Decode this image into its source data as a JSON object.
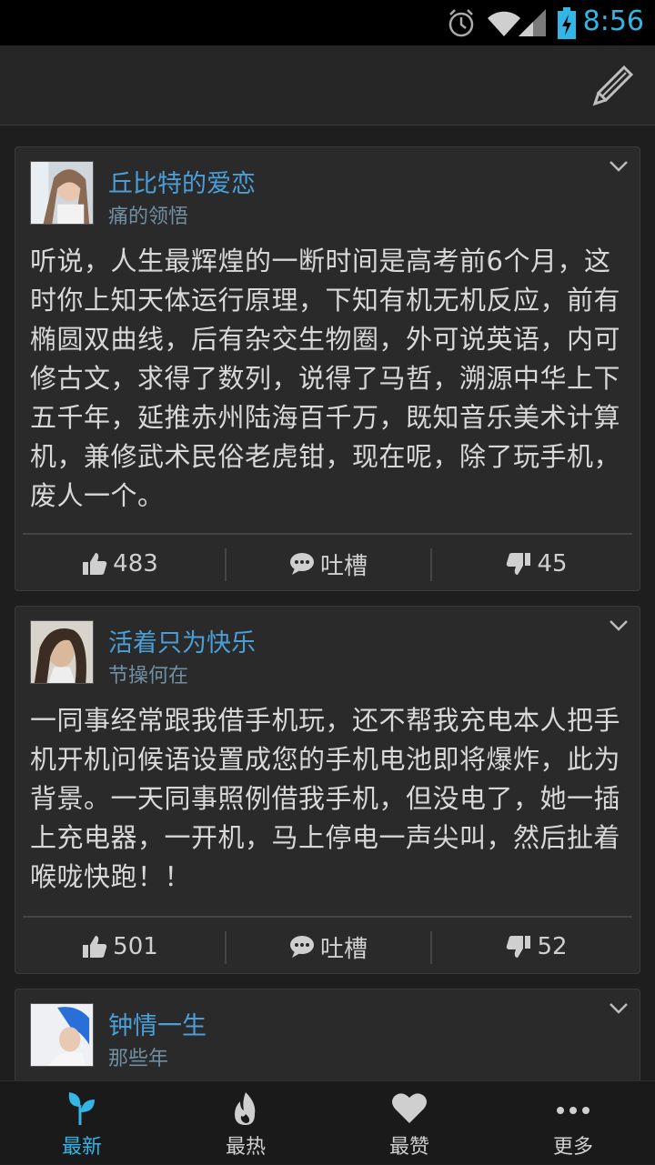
{
  "status_bar": {
    "time": "8:56"
  },
  "nav": {
    "tabs": [
      {
        "label": "最新",
        "icon": "sprout-icon",
        "active": true
      },
      {
        "label": "最热",
        "icon": "flame-icon",
        "active": false
      },
      {
        "label": "最赞",
        "icon": "heart-icon",
        "active": false
      },
      {
        "label": "更多",
        "icon": "more-icon",
        "active": false
      }
    ]
  },
  "posts": [
    {
      "username": "丘比特的爱恋",
      "category": "痛的领悟",
      "content": "听说，人生最辉煌的一断时间是高考前6个月，这时你上知天体运行原理，下知有机无机反应，前有椭圆双曲线，后有杂交生物圈，外可说英语，内可修古文，求得了数列，说得了马哲，溯源中华上下五千年，延推赤州陆海百千万，既知音乐美术计算机，兼修武术民俗老虎钳，现在呢，除了玩手机，废人一个。",
      "likes": "483",
      "comment_label": "吐槽",
      "dislikes": "45"
    },
    {
      "username": "活着只为快乐",
      "category": "节操何在",
      "content": "一同事经常跟我借手机玩，还不帮我充电本人把手机开机问候语设置成您的手机电池即将爆炸，此为背景。一天同事照例借我手机，但没电了，她一插上充电器，一开机，马上停电一声尖叫，然后扯着喉咙快跑！！",
      "likes": "501",
      "comment_label": "吐槽",
      "dislikes": "52"
    },
    {
      "username": "钟情一生",
      "category": "那些年"
    }
  ],
  "colors": {
    "accent": "#33b5e5",
    "username": "#4a9fd8",
    "category": "#6f8fa3"
  }
}
